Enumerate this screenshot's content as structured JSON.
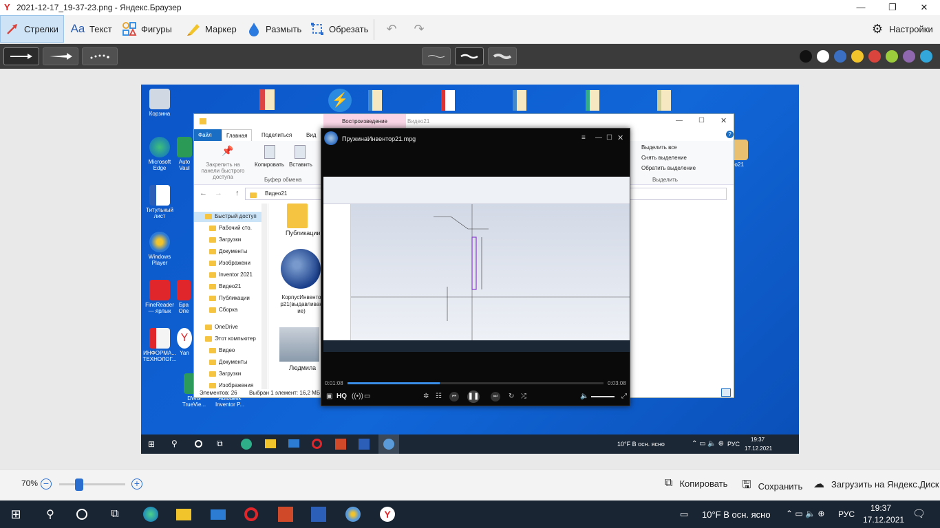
{
  "window": {
    "title": "2021-12-17_19-37-23.png - Яндекс.Браузер",
    "minimize": "—",
    "restore": "❐",
    "close": "✕"
  },
  "toolbar": {
    "arrows": "Стрелки",
    "text": "Текст",
    "shapes": "Фигуры",
    "marker": "Маркер",
    "blur": "Размыть",
    "crop": "Обрезать",
    "settings": "Настройки"
  },
  "colors": [
    "#111111",
    "#ffffff",
    "#3a6fc2",
    "#f2c42c",
    "#d9443c",
    "#9ccc3c",
    "#8f68b0",
    "#33a7d9"
  ],
  "desktop": {
    "icons": {
      "recycle": "Корзина",
      "edge": "Microsoft Edge",
      "word": "Титульный лист",
      "wmp": "Windows Player",
      "finereader": "FineReader — ярлык",
      "info": "ИНФОРМА... ТЕХНОЛОГ...",
      "br": "Бра Опе",
      "auto": "Auto Vaul",
      "ya": "Yan",
      "dwg": "DWG TrueVie...",
      "autodesk": "Autodesk Inventor P...",
      "video21": "ео21"
    }
  },
  "explorer": {
    "quick_title": "Видео21",
    "tab_play": "Воспроизведение",
    "tab_file": "Файл",
    "tab_home": "Главная",
    "tab_share": "Поделиться",
    "tab_view": "Вид",
    "pin": "Закрепить на панели быстрого доступа",
    "copy": "Копировать",
    "paste": "Вставить",
    "clipboard": "Буфер обмена",
    "select_all": "Выделить все",
    "select_none": "Снять выделение",
    "invert": "Обратить выделение",
    "select_group": "Выделить",
    "path": "Видео21",
    "nav": [
      "Быстрый доступ",
      "Рабочий сто.",
      "Загрузки",
      "Документы",
      "Изображени",
      "Inventor 2021",
      "Видео21",
      "Публикации",
      "Сборка",
      "OneDrive",
      "Этот компьютер",
      "Видео",
      "Документы",
      "Загрузки",
      "Изображения"
    ],
    "files": {
      "pub": "Публикации",
      "korpus": "КорпусИнвенто р21(выдавливан ие)",
      "lyudmila": "Людмила"
    },
    "status_count": "Элементов: 26",
    "status_sel": "Выбран 1 элемент: 16,2 МБ"
  },
  "player": {
    "title": "ПружинаИнвентор21.mpg",
    "time_current": "0:01:08",
    "time_total": "0:03:08",
    "hq": "HQ",
    "progress": 0.36
  },
  "inner_taskbar": {
    "weather": "10°F  В осн. ясно",
    "lang": "РУС",
    "time": "19:37",
    "date": "17.12.2021"
  },
  "bottom": {
    "zoom": "70%",
    "zoom_level": 0.3,
    "copy": "Копировать",
    "save": "Сохранить",
    "upload": "Загрузить на Яндекс.Диск"
  },
  "taskbar": {
    "weather": "10°F  В осн. ясно",
    "lang": "РУС",
    "time": "19:37",
    "date": "17.12.2021"
  }
}
